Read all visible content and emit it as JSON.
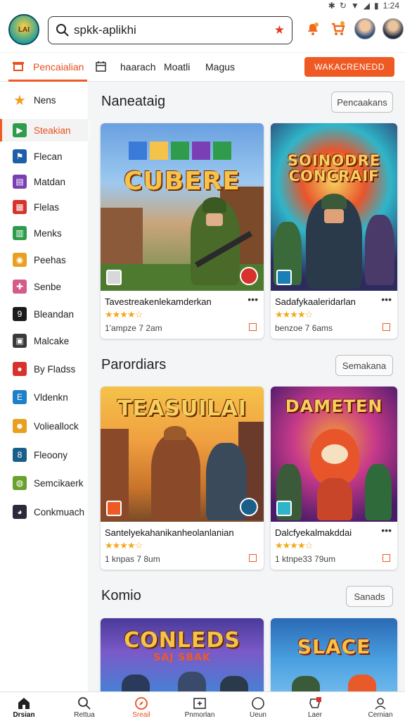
{
  "status_bar": {
    "time": "1:24"
  },
  "header": {
    "logo_text": "LAI",
    "search_value": "spkk-aplikhi"
  },
  "tabs": {
    "items": [
      "Pencaialian",
      "haarach",
      "Moatli",
      "Magus"
    ],
    "cta": "WAKACRENEDD"
  },
  "sidebar": {
    "items": [
      {
        "label": "Nens",
        "icon": "star-icon",
        "color": "#f39c1e"
      },
      {
        "label": "Steakian",
        "icon": "play-icon",
        "color": "#2e9c4a"
      },
      {
        "label": "Flecan",
        "icon": "flag-icon",
        "color": "#1f5fa8"
      },
      {
        "label": "Matdan",
        "icon": "chat-icon",
        "color": "#7b3fb5"
      },
      {
        "label": "Flelas",
        "icon": "grid-icon",
        "color": "#d7322b"
      },
      {
        "label": "Menks",
        "icon": "chart-icon",
        "color": "#2e9c4a"
      },
      {
        "label": "Peehas",
        "icon": "game-icon",
        "color": "#e8a020"
      },
      {
        "label": "Senbe",
        "icon": "puzzle-icon",
        "color": "#d45c8a"
      },
      {
        "label": "Bleandan",
        "icon": "dial-icon",
        "color": "#1a1a1a"
      },
      {
        "label": "Malcake",
        "icon": "box-icon",
        "color": "#3a3a3a"
      },
      {
        "label": "By Fladss",
        "icon": "apple-icon",
        "color": "#d7322b"
      },
      {
        "label": "Vldenkn",
        "icon": "doc-icon",
        "color": "#1f7fc8"
      },
      {
        "label": "Volieallock",
        "icon": "face-icon",
        "color": "#e8a020"
      },
      {
        "label": "Fleoony",
        "icon": "number-icon",
        "color": "#1a5f8a"
      },
      {
        "label": "Semcikaerk",
        "icon": "planet-icon",
        "color": "#6aa12e"
      },
      {
        "label": "Conkmuach",
        "icon": "ball-icon",
        "color": "#2a2a3a"
      }
    ],
    "active_index": 1
  },
  "sections": [
    {
      "title": "Naneataig",
      "button": "Pencaakans",
      "cards": [
        {
          "art_title": "CUBERE",
          "title": "Tavestreakenlekamderkan",
          "rating": 3.5,
          "stars": "★★★★☆",
          "meta": "1'ampze 7 2am",
          "colors": [
            "#5a8fd8",
            "#8ec45a",
            "#c9a572"
          ]
        },
        {
          "art_title": "SOINODRE CONCRAIF",
          "title": "Sadafykaaleridarlan",
          "rating": 4,
          "stars": "★★★★☆",
          "meta": "benzoe 7 6ams",
          "colors": [
            "#2c2a5e",
            "#e8552b",
            "#2fb5c9"
          ]
        }
      ]
    },
    {
      "title": "Parordiars",
      "button": "Semakana",
      "cards": [
        {
          "art_title": "TEASUILAI",
          "title": "Santelyekahanikanheolanlanian",
          "rating": 3.5,
          "stars": "★★★★☆",
          "meta": "1 knpas 7 8um",
          "colors": [
            "#f5c24a",
            "#c8742a",
            "#7a4a2a"
          ]
        },
        {
          "art_title": "DAMETEN",
          "title": "Dalcfyekalmakddai",
          "rating": 4,
          "stars": "★★★★☆",
          "meta": "1 ktnpe33 79um",
          "colors": [
            "#6a2a8a",
            "#e8552b",
            "#f5c24a"
          ]
        }
      ]
    },
    {
      "title": "Komio",
      "button": "Sanads",
      "cards": [
        {
          "art_title": "CONLEDS",
          "art_sub": "SAJ SBAK",
          "colors": [
            "#4a3a9a",
            "#f5a030",
            "#3a8ad8"
          ]
        },
        {
          "art_title": "SLACE",
          "colors": [
            "#2a6ab5",
            "#e85a2a",
            "#f5c24a"
          ]
        }
      ]
    }
  ],
  "bottom_nav": {
    "items": [
      {
        "label": "Drsian",
        "icon": "home-icon"
      },
      {
        "label": "Rettua",
        "icon": "search-icon"
      },
      {
        "label": "Sreail",
        "icon": "compass-icon"
      },
      {
        "label": "Pnmorlan",
        "icon": "plus-box-icon"
      },
      {
        "label": "Ueun",
        "icon": "circle-icon"
      },
      {
        "label": "Laer",
        "icon": "badge-icon"
      },
      {
        "label": "Cernian",
        "icon": "user-icon"
      }
    ]
  }
}
